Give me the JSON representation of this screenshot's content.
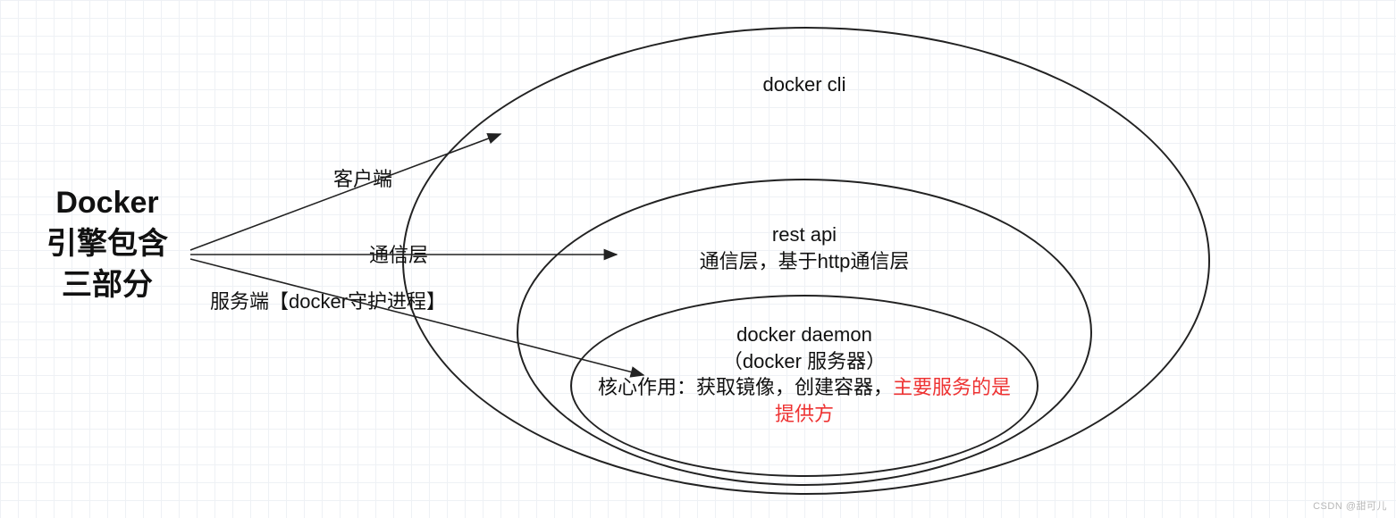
{
  "title": "Docker\n引擎包含\n三部分",
  "arrows": {
    "client_label": "客户端",
    "comm_label": "通信层",
    "server_label": "服务端【docker守护进程】"
  },
  "outer": {
    "label": "docker cli"
  },
  "mid": {
    "line1": "rest api",
    "line2": "通信层，基于http通信层"
  },
  "inner": {
    "line1": "docker daemon",
    "line2": "（docker 服务器）",
    "line3_pre": "核心作用：获取镜像，创建容器，",
    "line3_red": "主要服务的是提供方"
  },
  "watermark": "CSDN @甜可儿"
}
